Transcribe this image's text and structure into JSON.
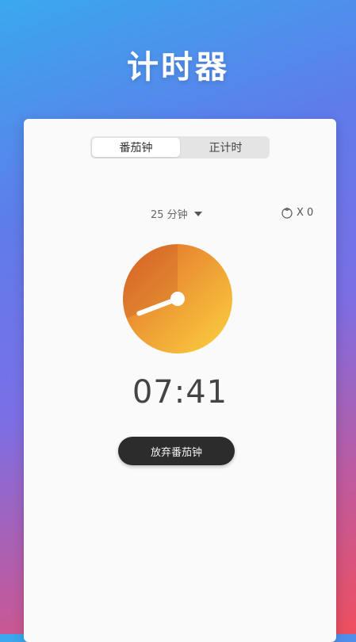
{
  "app": {
    "title": "计时器"
  },
  "tabs": [
    {
      "label": "番茄钟",
      "active": true
    },
    {
      "label": "正计时",
      "active": false
    }
  ],
  "timer": {
    "duration_label": "25 分钟",
    "tomato_count_label": "X 0",
    "time_display": "07:41",
    "abandon_label": "放弃番茄钟",
    "progress_fraction": 0.3076
  },
  "colors": {
    "accent_dark": "#d85a2a",
    "accent_light": "#fbc93c",
    "button_bg": "#2c2c2c"
  },
  "icons": {
    "dropdown": "caret-down-icon",
    "tomato": "tomato-icon"
  }
}
